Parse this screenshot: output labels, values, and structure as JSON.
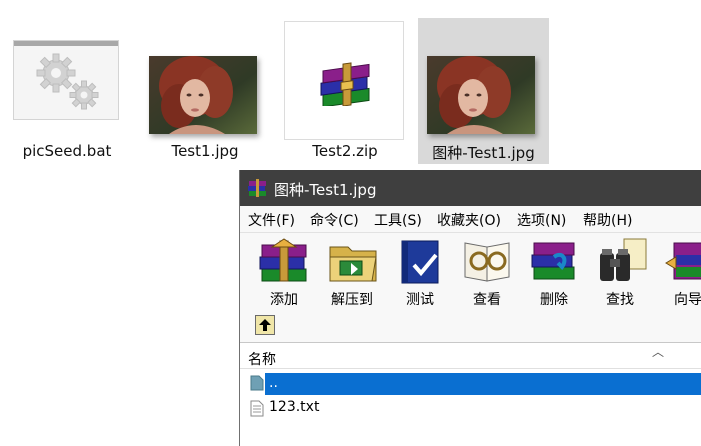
{
  "desktop": {
    "files": [
      {
        "name": "picSeed.bat",
        "icon": "gears-batch-icon"
      },
      {
        "name": "Test1.jpg",
        "icon": "photo-thumbnail"
      },
      {
        "name": "Test2.zip",
        "icon": "winrar-archive-icon"
      },
      {
        "name": "图种-Test1.jpg",
        "icon": "photo-thumbnail",
        "selected": true
      }
    ]
  },
  "window": {
    "title": "图种-Test1.jpg",
    "menu": [
      "文件(F)",
      "命令(C)",
      "工具(S)",
      "收藏夹(O)",
      "选项(N)",
      "帮助(H)"
    ],
    "toolbar": [
      "添加",
      "解压到",
      "测试",
      "查看",
      "删除",
      "查找",
      "向导"
    ],
    "list": {
      "column_name": "名称",
      "rows": [
        {
          "name": "..",
          "icon": "parent-folder-icon",
          "selected": true
        },
        {
          "name": "123.txt",
          "icon": "text-file-icon",
          "selected": false
        }
      ]
    }
  },
  "colors": {
    "titlebar": "#3f3f3f",
    "selection": "#0a6fd1",
    "tile_selected": "#d9d9d9"
  }
}
